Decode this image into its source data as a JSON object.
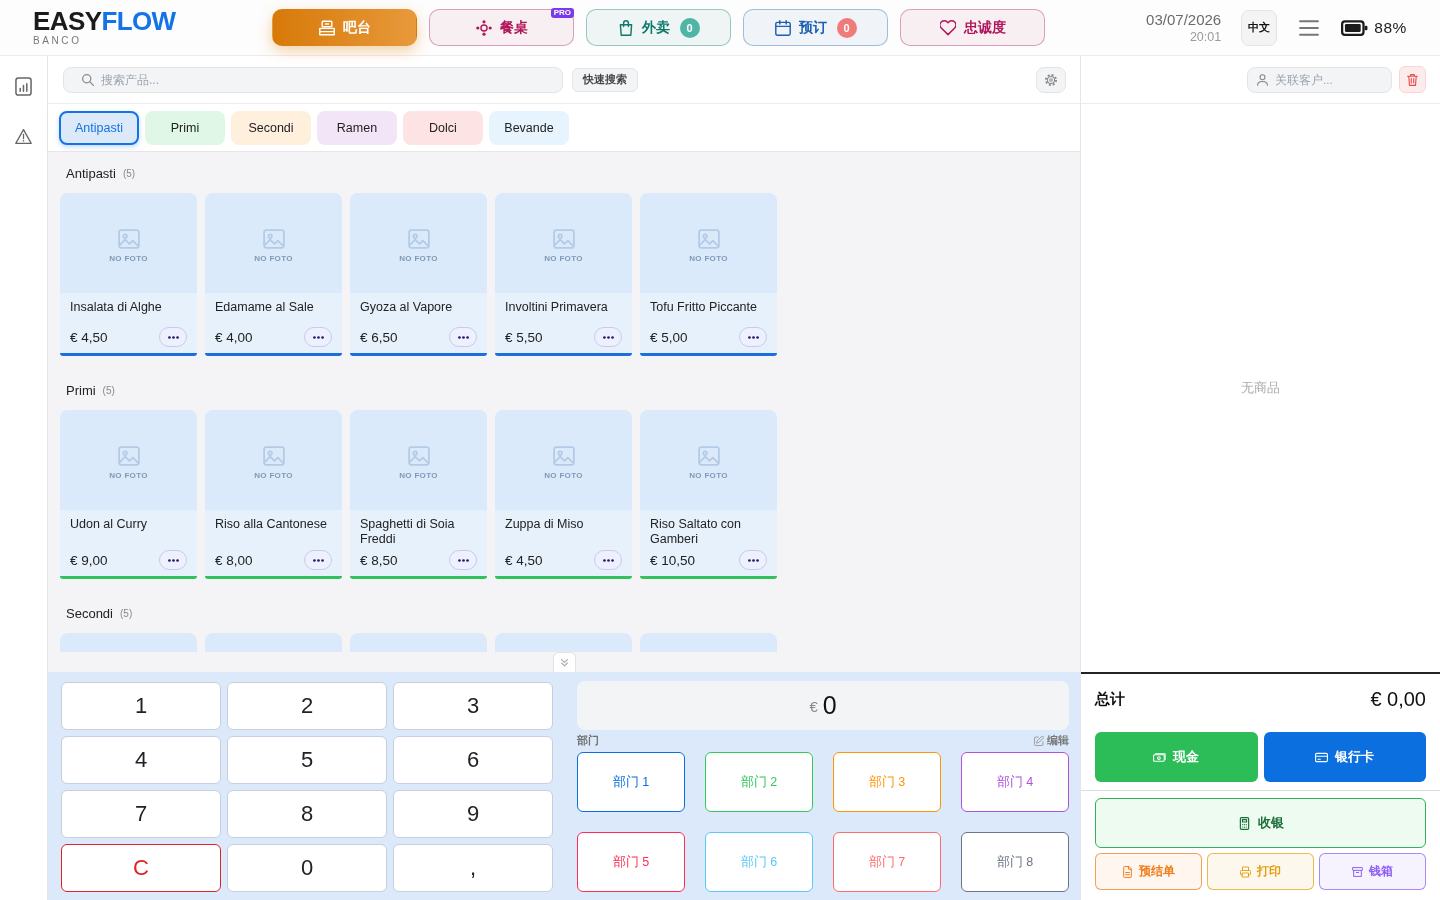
{
  "header": {
    "logo": {
      "first": "EASY",
      "second": "FLOW",
      "subtitle": "BANCO"
    },
    "nav": [
      {
        "label": "吧台",
        "selected": true,
        "color": "#e2800a"
      },
      {
        "label": "餐桌",
        "selected": false,
        "color": "#b0175b",
        "tag": "PRO"
      },
      {
        "label": "外卖",
        "selected": false,
        "color": "#0f7a6c",
        "count": {
          "text": "0",
          "color": "#4fb5a5"
        }
      },
      {
        "label": "预订",
        "selected": false,
        "color": "#1d5fae",
        "count": {
          "text": "0",
          "color": "#ef7b7b"
        }
      },
      {
        "label": "忠诚度",
        "selected": false,
        "color": "#b0175b"
      }
    ],
    "date": "03/07/2026",
    "time": "20:01",
    "language": "中文",
    "battery": "88%"
  },
  "search": {
    "placeholder": "搜索产品...",
    "quick_button": "快速搜索"
  },
  "categories": [
    {
      "label": "Antipasti",
      "selected": true,
      "color": "#dce9f9"
    },
    {
      "label": "Primi",
      "selected": false,
      "color": "#e0f6e7"
    },
    {
      "label": "Secondi",
      "selected": false,
      "color": "#fff0de"
    },
    {
      "label": "Ramen",
      "selected": false,
      "color": "#f3e5f8"
    },
    {
      "label": "Dolci",
      "selected": false,
      "color": "#fde3e4"
    },
    {
      "label": "Bevande",
      "selected": false,
      "color": "#e7f4fd"
    }
  ],
  "sections": [
    {
      "title": "Antipasti",
      "count": "(5)",
      "color": "#1a6fdc",
      "products": [
        {
          "kind": "full",
          "name": "Insalata di Alghe",
          "price": "€ 4,50",
          "photo_label": "NO FOTO"
        },
        {
          "kind": "full",
          "name": "Edamame al Sale",
          "price": "€ 4,00",
          "photo_label": "NO FOTO"
        },
        {
          "kind": "full",
          "name": "Gyoza al Vapore",
          "price": "€ 6,50",
          "photo_label": "NO FOTO"
        },
        {
          "kind": "full",
          "name": "Involtini Primavera",
          "price": "€ 5,50",
          "photo_label": "NO FOTO"
        },
        {
          "kind": "full",
          "name": "Tofu Fritto Piccante",
          "price": "€ 5,00",
          "photo_label": "NO FOTO"
        }
      ]
    },
    {
      "title": "Primi",
      "count": "(5)",
      "color": "#33c05f",
      "products": [
        {
          "kind": "full",
          "name": "Udon al Curry",
          "price": "€ 9,00",
          "photo_label": "NO FOTO"
        },
        {
          "kind": "full",
          "name": "Riso alla Cantonese",
          "price": "€ 8,00",
          "photo_label": "NO FOTO"
        },
        {
          "kind": "full",
          "name": "Spaghetti di Soia Freddi",
          "price": "€ 8,50",
          "photo_label": "NO FOTO"
        },
        {
          "kind": "full",
          "name": "Zuppa di Miso",
          "price": "€ 4,50",
          "photo_label": "NO FOTO"
        },
        {
          "kind": "full",
          "name": "Riso Saltato con Gamberi",
          "price": "€ 10,50",
          "photo_label": "NO FOTO"
        }
      ]
    },
    {
      "title": "Secondi",
      "count": "(5)",
      "products": [
        {
          "kind": "partial"
        },
        {
          "kind": "partial"
        },
        {
          "kind": "partial"
        },
        {
          "kind": "partial"
        },
        {
          "kind": "partial"
        }
      ]
    }
  ],
  "keypad": [
    {
      "label": "1",
      "kind": "digit"
    },
    {
      "label": "2",
      "kind": "digit"
    },
    {
      "label": "3",
      "kind": "digit"
    },
    {
      "label": "4",
      "kind": "digit"
    },
    {
      "label": "5",
      "kind": "digit"
    },
    {
      "label": "6",
      "kind": "digit"
    },
    {
      "label": "7",
      "kind": "digit"
    },
    {
      "label": "8",
      "kind": "digit"
    },
    {
      "label": "9",
      "kind": "digit"
    },
    {
      "label": "C",
      "kind": "clear"
    },
    {
      "label": "0",
      "kind": "digit"
    },
    {
      "label": ",",
      "kind": "separator"
    }
  ],
  "amount": {
    "currency": "€",
    "value": "0"
  },
  "departments": {
    "title": "部门",
    "edit": "编辑",
    "items": [
      {
        "label": "部门 1",
        "color": "#0b6fe0"
      },
      {
        "label": "部门 2",
        "color": "#34c759"
      },
      {
        "label": "部门 3",
        "color": "#ff9500"
      },
      {
        "label": "部门 4",
        "color": "#af52de"
      },
      {
        "label": "部门 5",
        "color": "#ff2d55"
      },
      {
        "label": "部门 6",
        "color": "#5ac8fa"
      },
      {
        "label": "部门 7",
        "color": "#ff6b6b"
      },
      {
        "label": "部门 8",
        "color": "#6b7588"
      }
    ]
  },
  "order": {
    "customer_placeholder": "关联客户...",
    "empty_text": "无商品",
    "total_label": "总计",
    "total": "€ 0,00"
  },
  "payments": [
    {
      "label": "现金",
      "color": "#2dbd58"
    },
    {
      "label": "银行卡",
      "color": "#0b6fe0"
    }
  ],
  "checkout": {
    "label": "收银"
  },
  "tools": [
    {
      "label": "预结单",
      "color": "#f07c1a"
    },
    {
      "label": "打印",
      "color": "#e39e0c"
    },
    {
      "label": "钱箱",
      "color": "#8b5cf6"
    }
  ]
}
